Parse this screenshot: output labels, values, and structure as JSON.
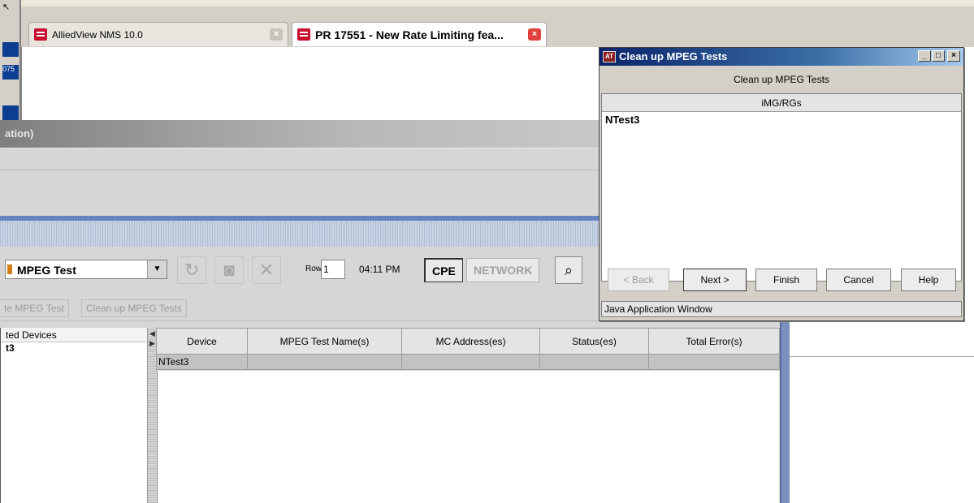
{
  "browser": {
    "tabs": [
      {
        "label": "AlliedView NMS 10.0",
        "active": false
      },
      {
        "label": "PR 17551 - New Rate Limiting fea...",
        "active": true
      }
    ],
    "left_strip_texts": [
      "075"
    ]
  },
  "app": {
    "title_fragment": "ation)",
    "toolbar": {
      "test_type_value": "MPEG Test",
      "rows_label": "Rows",
      "rows_value": "1",
      "time": "04:11 PM",
      "cpe_label": "CPE",
      "network_label": "NETWORK"
    },
    "actions": [
      "te MPEG Test",
      "Clean up MPEG Tests"
    ],
    "devices_panel": {
      "header": "ted Devices",
      "item": "t3"
    },
    "table": {
      "columns": [
        "Device",
        "MPEG Test Name(s)",
        "MC Address(es)",
        "Status(es)",
        "Total Error(s)"
      ],
      "rows": [
        [
          "NTest3",
          "",
          "",
          "",
          ""
        ]
      ]
    }
  },
  "dialog": {
    "title": "Clean up MPEG Tests",
    "heading": "Clean up MPEG Tests",
    "list_header": "iMG/RGs",
    "list_items": [
      "NTest3"
    ],
    "buttons": {
      "back": "< Back",
      "next": "Next >",
      "finish": "Finish",
      "cancel": "Cancel",
      "help": "Help"
    },
    "status": "Java Application Window"
  },
  "colors": {
    "title_bar": "#0a246a",
    "accent_blue": "#6584c0",
    "tab_icon_red": "#c8102e"
  }
}
